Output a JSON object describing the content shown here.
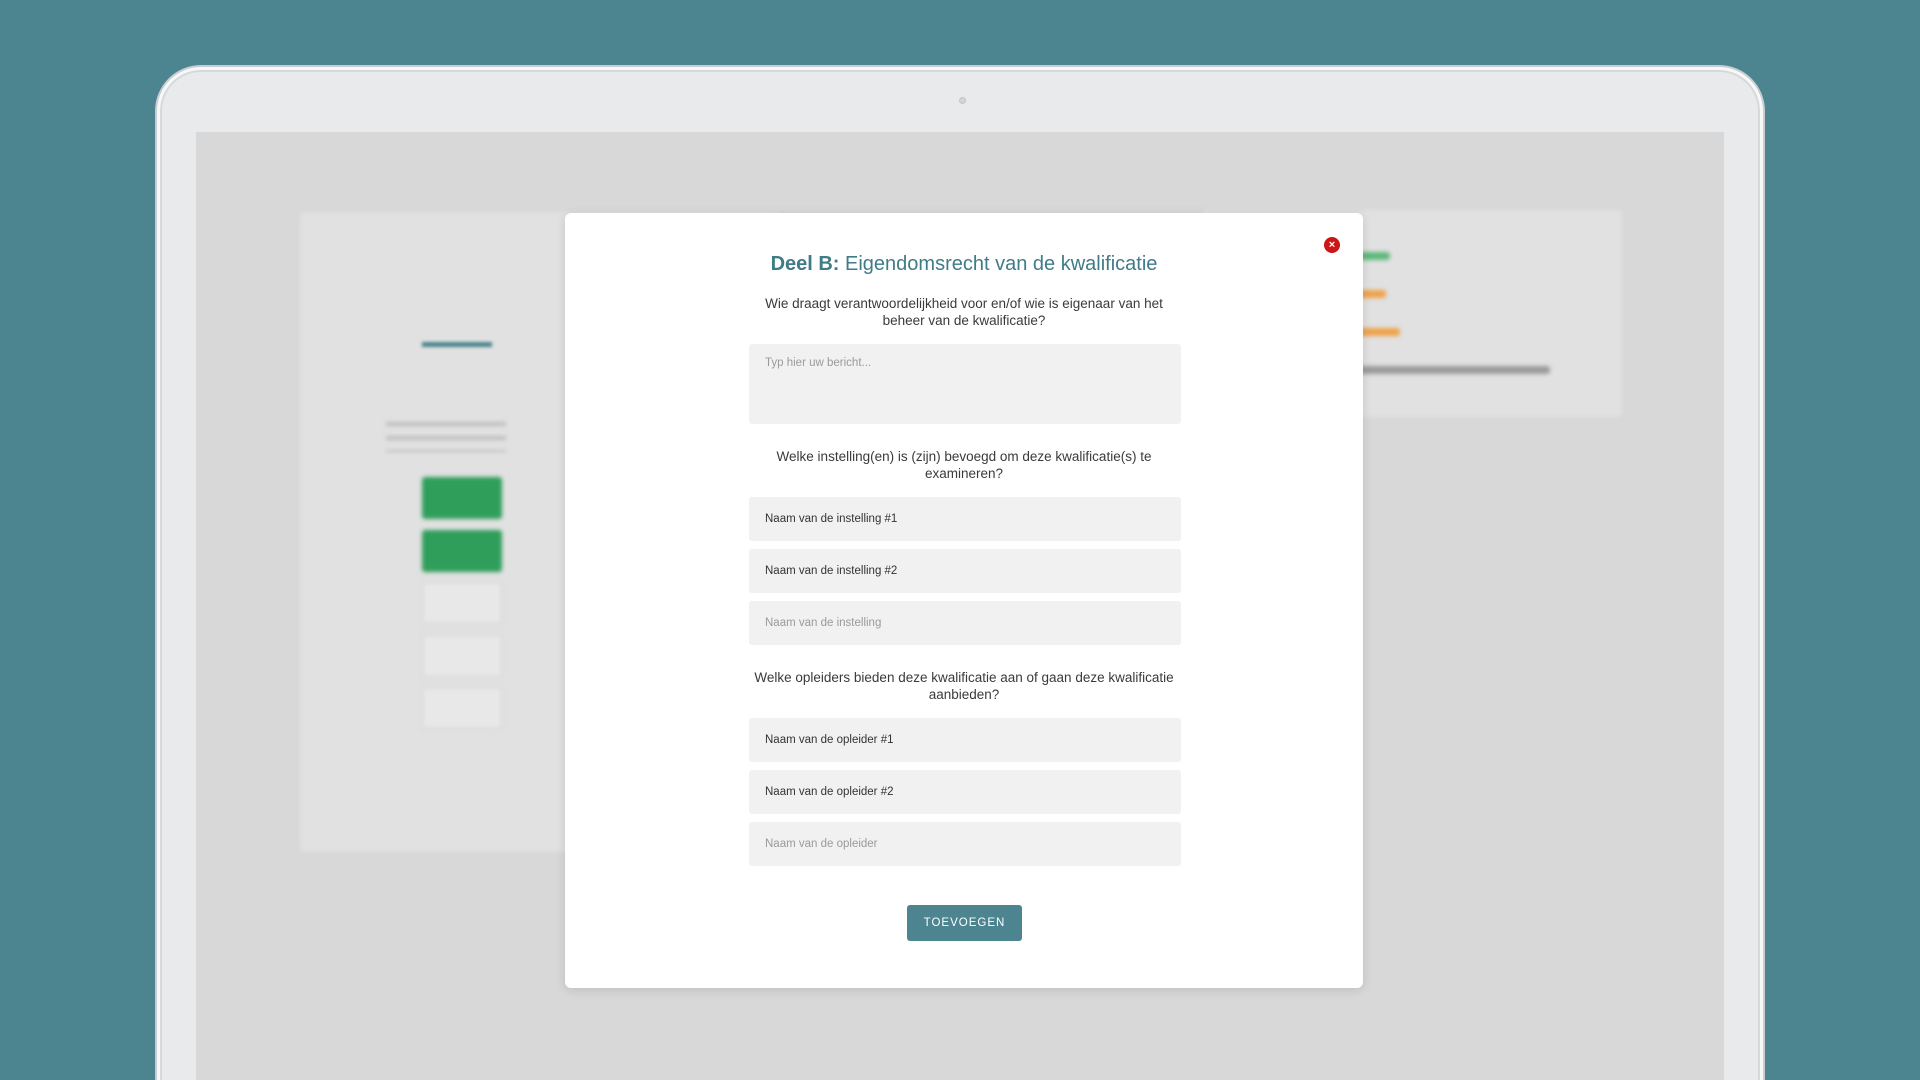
{
  "modal": {
    "title_prefix": "Deel B:",
    "title_rest": " Eigendomsrecht van de kwalificatie",
    "close_icon": "×",
    "q1": "Wie draagt verantwoordelijkheid voor en/of wie is eigenaar van het beheer van de kwalificatie?",
    "message_placeholder": "Typ hier uw bericht...",
    "q2": "Welke instelling(en) is (zijn) bevoegd om deze kwalificatie(s) te examineren?",
    "institutions": [
      "Naam van de instelling #1",
      "Naam van de instelling #2"
    ],
    "institution_placeholder": "Naam van de instelling",
    "q3": "Welke opleiders bieden deze kwalificatie aan of gaan deze kwalificatie aanbieden?",
    "providers": [
      "Naam van de opleider #1",
      "Naam van de opleider #2"
    ],
    "provider_placeholder": "Naam van de opleider",
    "submit_label": "TOEVOEGEN"
  },
  "colors": {
    "brand": "#4c8590",
    "close": "#cc1515",
    "success": "#2f9e5b"
  }
}
